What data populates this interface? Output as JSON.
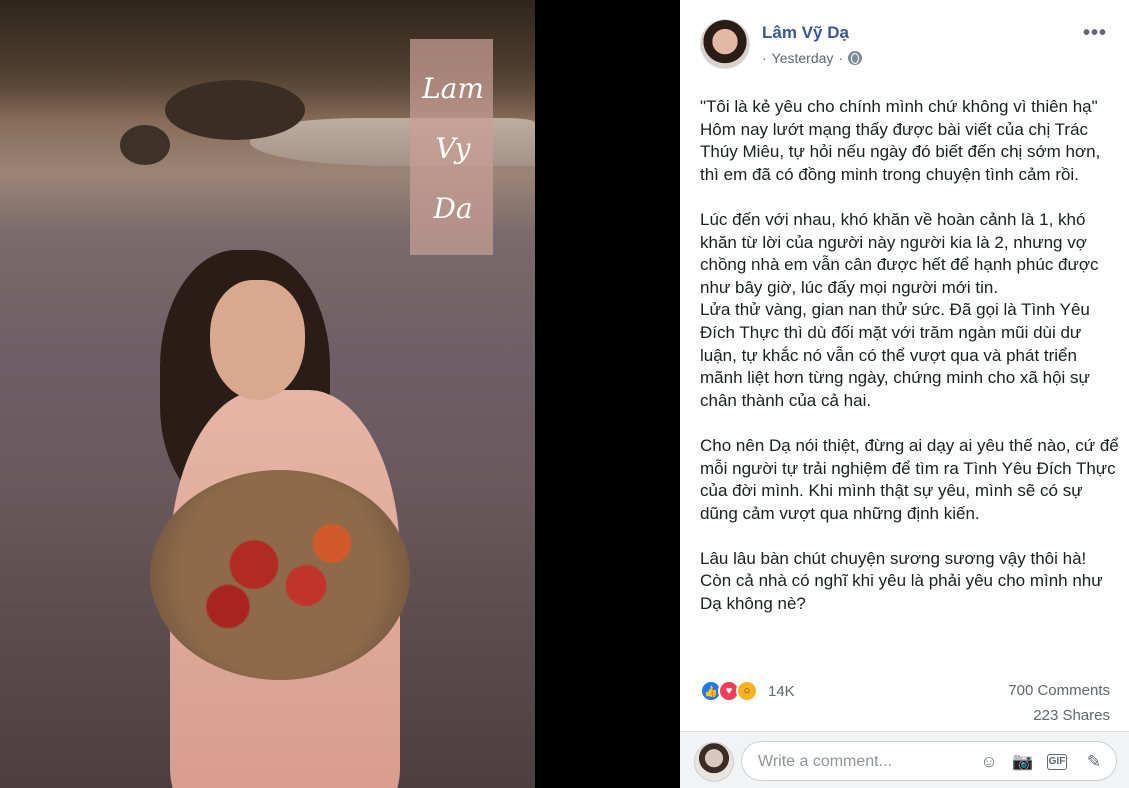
{
  "photo": {
    "overlay_signature": "Lam Vy Da"
  },
  "post": {
    "author": "Lâm Vỹ Dạ",
    "timestamp": "Yesterday",
    "separator": "·",
    "privacy_icon": "globe-icon",
    "more_icon": "•••",
    "paragraphs": [
      "\"Tôi là kẻ yêu cho chính mình chứ không vì thiên hạ\" Hôm nay lướt mạng thấy được bài viết của chị Trác Thúy Miêu, tự hỏi nếu ngày đó biết đến chị sớm hơn, thì em đã có đồng minh trong chuyện tình cảm rồi.",
      "Lúc đến với nhau, khó khăn về hoàn cảnh là 1, khó khăn từ lời của người này người kia là 2, nhưng vợ chồng nhà em vẫn cân được hết để hạnh phúc được như bây giờ, lúc đấy mọi người mới tin.\nLửa thử vàng, gian nan thử sức. Đã gọi là Tình Yêu Đích Thực thì dù đối mặt với trăm ngàn mũi dùi dư luận, tự khắc nó vẫn có thể vượt qua và phát triển mãnh liệt hơn từng ngày, chứng minh cho xã hội sự chân thành của cả hai.",
      "Cho nên Dạ nói thiệt, đừng ai dạy ai yêu thế nào, cứ để mỗi người tự trải nghiệm để tìm ra Tình Yêu Đích Thực của đời mình. Khi mình thật sự yêu, mình sẽ có sự dũng cảm vượt qua những định kiến.",
      "Lâu lâu bàn chút chuyện sương sương vậy thôi hà! Còn cả nhà có nghĩ khi yêu là phải yêu cho mình như Dạ không nè?"
    ],
    "reactions": {
      "icons": [
        "like-icon",
        "love-icon",
        "wow-icon"
      ],
      "count": "14K"
    },
    "comments_count": "700 Comments",
    "shares_count": "223 Shares"
  },
  "comment_box": {
    "placeholder": "Write a comment...",
    "icons": [
      "emoji-icon",
      "camera-icon",
      "gif-icon",
      "sticker-icon"
    ],
    "gif_label": "GIF"
  },
  "colors": {
    "author_link": "#385898",
    "like": "#2078f4",
    "love": "#f33e58",
    "wow": "#f7b125"
  }
}
